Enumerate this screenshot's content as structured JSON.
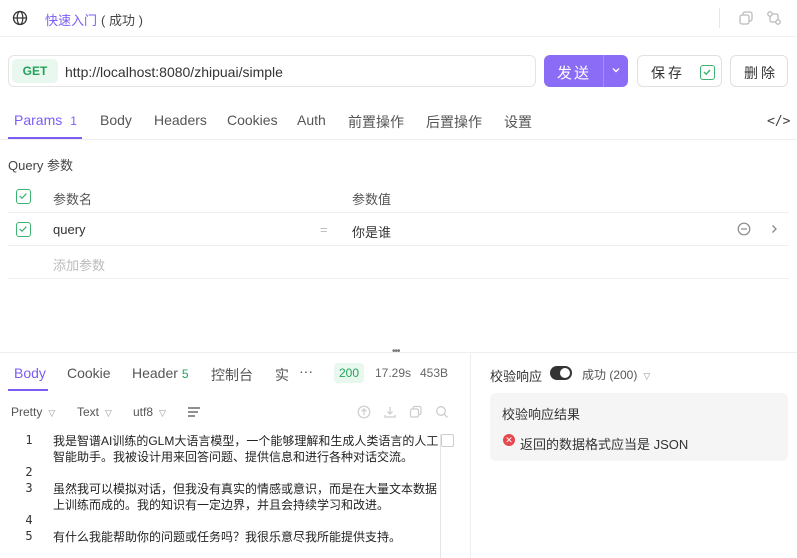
{
  "header": {
    "title": "快速入门",
    "status": "( 成功 )"
  },
  "request": {
    "method": "GET",
    "url": "http://localhost:8080/zhipuai/simple",
    "send_label": "发送",
    "save_label": "保存",
    "delete_label": "删除"
  },
  "tabs": {
    "params": "Params",
    "params_count": "1",
    "body": "Body",
    "headers": "Headers",
    "cookies": "Cookies",
    "auth": "Auth",
    "pre": "前置操作",
    "post": "后置操作",
    "settings": "设置"
  },
  "query": {
    "title": "Query 参数",
    "col_name": "参数名",
    "col_value": "参数值",
    "rows": [
      {
        "name": "query",
        "value": "你是谁"
      }
    ],
    "add_placeholder": "添加参数"
  },
  "response": {
    "tabs": {
      "body": "Body",
      "cookie": "Cookie",
      "header": "Header",
      "header_count": "5",
      "console": "控制台",
      "more": "实",
      "ellipsis": "···"
    },
    "status_code": "200",
    "time": "17.29s",
    "size": "453B",
    "format": {
      "view": "Pretty",
      "type": "Text",
      "encoding": "utf8"
    },
    "lines": [
      {
        "num": "1",
        "text": "我是智谱AI训练的GLM大语言模型，一个能够理解和生成人类语言的人工智能助手。我被设计用来回答问题、提供信息和进行各种对话交流。"
      },
      {
        "num": "2",
        "text": ""
      },
      {
        "num": "3",
        "text": "虽然我可以模拟对话，但我没有真实的情感或意识，而是在大量文本数据上训练而成的。我的知识有一定边界，并且会持续学习和改进。"
      },
      {
        "num": "4",
        "text": ""
      },
      {
        "num": "5",
        "text": "有什么我能帮助你的问题或任务吗？我很乐意尽我所能提供支持。"
      }
    ]
  },
  "validation": {
    "label": "校验响应",
    "selected": "成功 (200)",
    "result_title": "校验响应结果",
    "error_message": "返回的数据格式应当是 JSON"
  },
  "colors": {
    "accent": "#7c5cf5",
    "success": "#23a35b",
    "error": "#e5484d"
  }
}
